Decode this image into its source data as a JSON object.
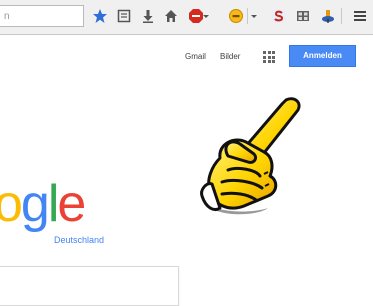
{
  "browser": {
    "url_fragment": "n",
    "toolbar_icons": [
      "bookmark-star-icon",
      "reading-list-icon",
      "download-icon",
      "home-icon",
      "adblock-icon",
      "emoji-icon",
      "extension-s-icon",
      "grid-extension-icon",
      "pin-extension-icon",
      "menu-icon"
    ]
  },
  "header": {
    "gmail_label": "Gmail",
    "images_label": "Bilder",
    "signin_label": "Anmelden"
  },
  "logo": {
    "text_o": "o",
    "text_g": "g",
    "text_l": "l",
    "text_e": "e",
    "country_label": "Deutschland"
  },
  "colors": {
    "accent": "#4a8af4",
    "google_blue": "#4285f4",
    "google_red": "#ea4335",
    "google_yellow": "#fbbc05",
    "google_green": "#34a853"
  }
}
